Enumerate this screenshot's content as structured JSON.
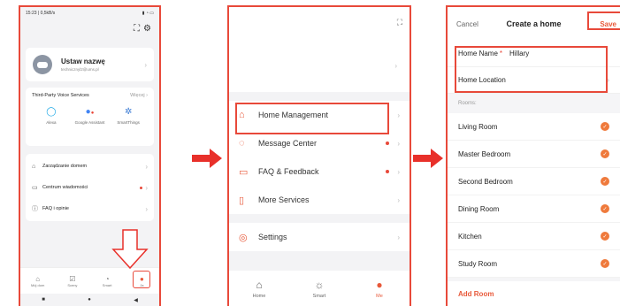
{
  "colors": {
    "accent": "#e8593a",
    "highlight": "#e8493a",
    "arrow": "#e8302a"
  },
  "screen1": {
    "status": "15:23 | 0,5kB/s",
    "profile": {
      "name": "Ustaw nazwę",
      "email": "technicznyl2@ums.pl"
    },
    "voice": {
      "title": "Third-Party Voice Services",
      "more": "Więcej",
      "items": [
        {
          "label": "Alexa",
          "icon": "alexa-icon"
        },
        {
          "label": "Google Assistant",
          "icon": "google-assistant-icon"
        },
        {
          "label": "SmartThings",
          "icon": "smartthings-icon"
        }
      ]
    },
    "menu": [
      {
        "label": "Zarządzanie domem",
        "icon": "home-icon"
      },
      {
        "label": "Centrum wiadomości",
        "icon": "message-icon"
      },
      {
        "label": "FAQ i opinie",
        "icon": "faq-icon"
      }
    ],
    "tabs": [
      {
        "label": "Mój dom",
        "icon": "home-icon"
      },
      {
        "label": "Sceny",
        "icon": "scene-icon"
      },
      {
        "label": "Smart",
        "icon": "smart-icon"
      },
      {
        "label": "Ja",
        "icon": "me-icon"
      }
    ]
  },
  "screen2": {
    "menu": [
      {
        "label": "Home Management",
        "icon": "home-icon"
      },
      {
        "label": "Message Center",
        "icon": "message-icon"
      },
      {
        "label": "FAQ & Feedback",
        "icon": "faq-icon"
      },
      {
        "label": "More Services",
        "icon": "bookmark-icon"
      }
    ],
    "settings": {
      "label": "Settings",
      "icon": "settings-icon"
    },
    "tabs": [
      {
        "label": "Home",
        "icon": "home-icon"
      },
      {
        "label": "Smart",
        "icon": "smart-icon"
      },
      {
        "label": "Me",
        "icon": "me-icon"
      }
    ]
  },
  "screen3": {
    "cancel": "Cancel",
    "title": "Create a home",
    "save": "Save",
    "home_name_label": "Home Name",
    "home_name_required": "*",
    "home_name_value": "Hillary",
    "home_location_label": "Home Location",
    "rooms_label": "Rooms:",
    "rooms": [
      "Living Room",
      "Master Bedroom",
      "Second Bedroom",
      "Dining Room",
      "Kitchen",
      "Study Room"
    ],
    "add_room": "Add Room"
  }
}
